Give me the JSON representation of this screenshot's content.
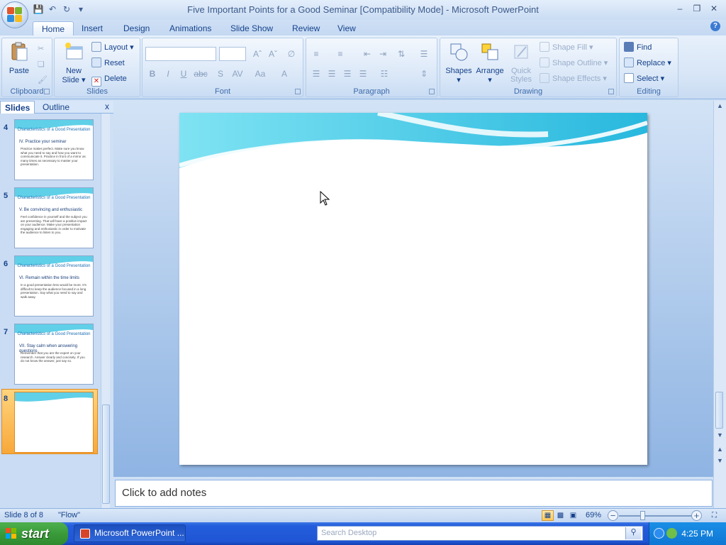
{
  "window": {
    "title": "Five Important Points for a Good Seminar [Compatibility Mode] - Microsoft PowerPoint"
  },
  "qat": {
    "save": "save-icon",
    "undo": "undo-icon",
    "redo": "redo-icon",
    "customize": "customize-icon"
  },
  "ribbon_tabs": [
    "Home",
    "Insert",
    "Design",
    "Animations",
    "Slide Show",
    "Review",
    "View"
  ],
  "ribbon": {
    "clipboard": {
      "label": "Clipboard",
      "paste": "Paste"
    },
    "slides": {
      "label": "Slides",
      "new_slide_1": "New",
      "new_slide_2": "Slide",
      "layout": "Layout",
      "reset": "Reset",
      "delete": "Delete"
    },
    "font": {
      "label": "Font",
      "font_value": "",
      "size_value": ""
    },
    "paragraph": {
      "label": "Paragraph"
    },
    "drawing": {
      "label": "Drawing",
      "shapes": "Shapes",
      "arrange": "Arrange",
      "quick_styles_1": "Quick",
      "quick_styles_2": "Styles",
      "shape_fill": "Shape Fill",
      "shape_outline": "Shape Outline",
      "shape_effects": "Shape Effects"
    },
    "editing": {
      "label": "Editing",
      "find": "Find",
      "replace": "Replace",
      "select": "Select"
    }
  },
  "pane": {
    "tab_slides": "Slides",
    "tab_outline": "Outline",
    "close": "x",
    "thumbs": [
      {
        "num": "4",
        "title": "Characteristics of a Good Presentation",
        "head": "IV. Practice your seminar",
        "body": "Practice makes perfect. Make sure you know what you need to say and how you want to communicate it. Practice in front of a mirror as many times as necessary to master your presentation."
      },
      {
        "num": "5",
        "title": "Characteristics of a Good Presentation",
        "head": "V. Be convincing and enthusiastic",
        "body": "Feel confidence in yourself and the subject you are presenting. That will have a positive impact on your audience. Make your presentation engaging and enthusiastic in order to motivate the audience to listen to you."
      },
      {
        "num": "6",
        "title": "Characteristics of a Good Presentation",
        "head": "VI. Remain within the time limits",
        "body": "In a good presentation less would be more. It's difficult to keep the audience focused in a long presentation. Say what you need to say and walk away."
      },
      {
        "num": "7",
        "title": "Characteristics of a Good Presentation",
        "head": "VII. Stay calm when answering questions",
        "body": "Remember that you are the expert on your research. Answer clearly and concisely. If you do not know the answer, just say so."
      },
      {
        "num": "8"
      }
    ]
  },
  "notes": {
    "placeholder": "Click to add notes"
  },
  "status": {
    "slide_info": "Slide 8 of 8",
    "theme": "\"Flow\"",
    "zoom": "69%"
  },
  "taskbar": {
    "start": "start",
    "task_item": "Microsoft PowerPoint ...",
    "search_placeholder": "Search Desktop",
    "clock": "4:25 PM"
  },
  "colors": {
    "ribbon_text": "#15428b",
    "selected_slide": "#f8a83a",
    "taskbar": "#245edc",
    "start": "#3a9b3a"
  }
}
